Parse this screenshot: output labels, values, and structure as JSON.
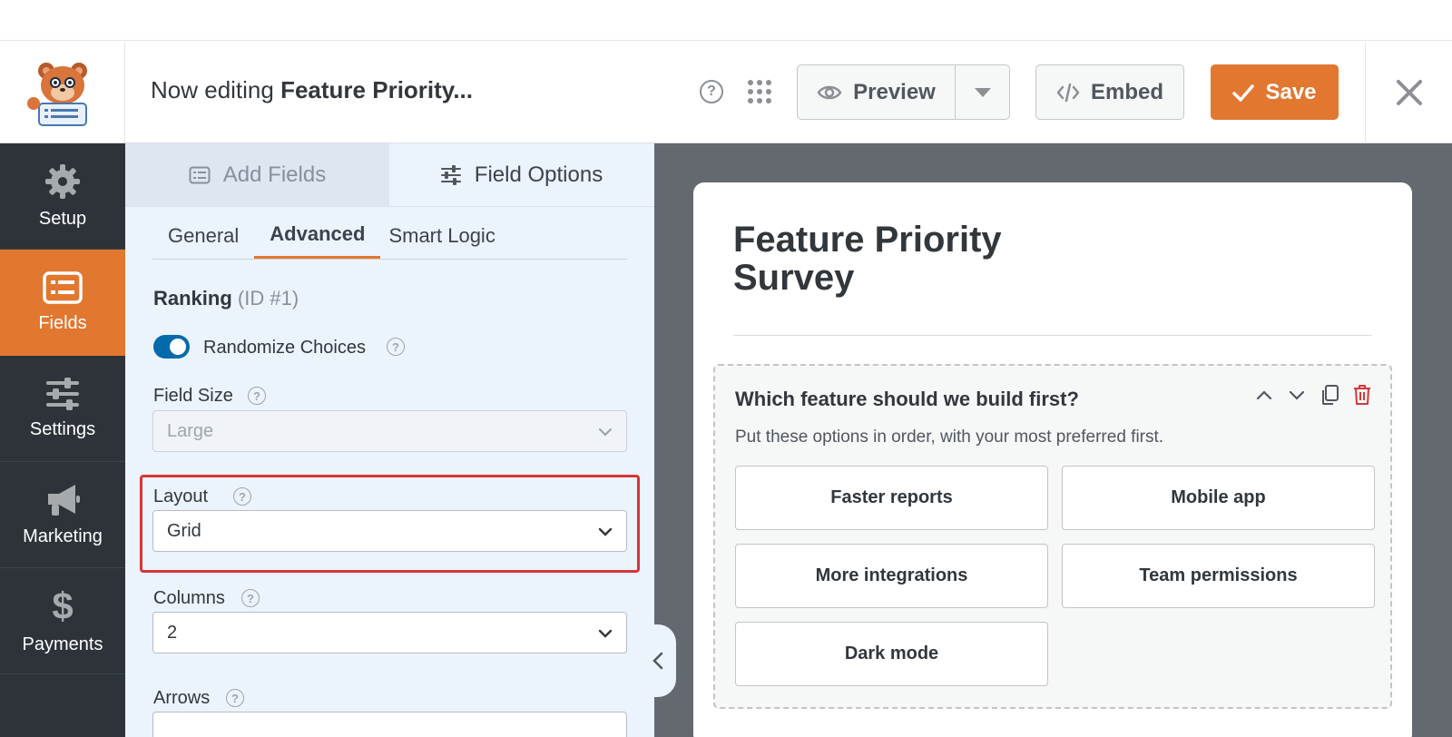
{
  "header": {
    "editing_prefix": "Now editing",
    "form_name": "Feature Priority...",
    "preview_label": "Preview",
    "embed_label": "Embed",
    "save_label": "Save"
  },
  "sidebar": {
    "items": [
      {
        "label": "Setup",
        "icon": "gear-icon"
      },
      {
        "label": "Fields",
        "icon": "list-icon",
        "active": true
      },
      {
        "label": "Settings",
        "icon": "sliders-icon"
      },
      {
        "label": "Marketing",
        "icon": "megaphone-icon"
      },
      {
        "label": "Payments",
        "icon": "dollar-icon"
      }
    ]
  },
  "panel": {
    "tabs": {
      "add_fields": "Add Fields",
      "field_options": "Field Options"
    },
    "subtabs": {
      "general": "General",
      "advanced": "Advanced",
      "smart_logic": "Smart Logic"
    },
    "field_name": "Ranking",
    "field_id": "(ID #1)",
    "randomize_label": "Randomize Choices",
    "randomize_on": true,
    "field_size_label": "Field Size",
    "field_size_value": "Large",
    "layout_label": "Layout",
    "layout_value": "Grid",
    "columns_label": "Columns",
    "columns_value": "2",
    "arrows_label": "Arrows"
  },
  "preview": {
    "form_title": "Feature Priority Survey",
    "question": "Which feature should we build first?",
    "description": "Put these options in order, with your most preferred first.",
    "options": [
      "Faster reports",
      "Mobile app",
      "More integrations",
      "Team permissions",
      "Dark mode"
    ]
  },
  "colors": {
    "accent": "#e27730",
    "sidebar_bg": "#2d3338",
    "panel_bg": "#ebf3fc",
    "highlight": "#d63638",
    "toggle": "#056aab",
    "delete": "#d63638"
  }
}
